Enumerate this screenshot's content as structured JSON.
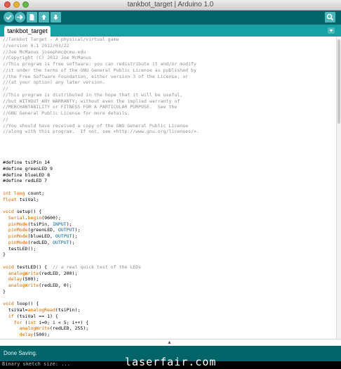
{
  "window": {
    "title": "tankbot_target | Arduino 1.0"
  },
  "toolbar": {
    "buttons": [
      {
        "name": "verify",
        "icon": "check-icon"
      },
      {
        "name": "upload",
        "icon": "right-arrow-icon"
      },
      {
        "name": "new",
        "icon": "new-file-icon"
      },
      {
        "name": "open",
        "icon": "up-arrow-icon"
      },
      {
        "name": "save",
        "icon": "down-arrow-icon"
      },
      {
        "name": "serial-monitor",
        "icon": "magnifier-icon"
      }
    ]
  },
  "tabs": [
    {
      "label": "tankbot_target"
    }
  ],
  "editor": {
    "lines": [
      [
        {
          "t": "//Tankbot Target - A physical/virtual game",
          "c": "comment"
        }
      ],
      [
        {
          "t": "//version 0.1 2012/03/22",
          "c": "comment"
        }
      ],
      [
        {
          "t": "//Joe McManus josephmc@cmu.edu",
          "c": "comment"
        }
      ],
      [
        {
          "t": "//Copyright (C) 2012 Joe McManus",
          "c": "comment"
        }
      ],
      [
        {
          "t": "//This program is free software: you can redistribute it and/or modify",
          "c": "comment"
        }
      ],
      [
        {
          "t": "//it under the terms of the GNU General Public License as published by",
          "c": "comment"
        }
      ],
      [
        {
          "t": "//the Free Software Foundation, either version 3 of the License, or",
          "c": "comment"
        }
      ],
      [
        {
          "t": "//(at your option) any later version.",
          "c": "comment"
        }
      ],
      [
        {
          "t": "//",
          "c": "comment"
        }
      ],
      [
        {
          "t": "//This program is distributed in the hope that it will be useful,",
          "c": "comment"
        }
      ],
      [
        {
          "t": "//but WITHOUT ANY WARRANTY; without even the implied warranty of",
          "c": "comment"
        }
      ],
      [
        {
          "t": "//MERCHANTABILITY or FITNESS FOR A PARTICULAR PURPOSE.  See the",
          "c": "comment"
        }
      ],
      [
        {
          "t": "//GNU General Public License for more details.",
          "c": "comment"
        }
      ],
      [
        {
          "t": "//",
          "c": "comment"
        }
      ],
      [
        {
          "t": "//You should have received a copy of the GNU General Public License",
          "c": "comment"
        }
      ],
      [
        {
          "t": "//along with this program.  If not, see <http://www.gnu.org/licenses/>.",
          "c": "comment"
        }
      ],
      [],
      [],
      [],
      [],
      [
        {
          "t": "#define tsiPin 14"
        }
      ],
      [
        {
          "t": "#define greenLED 9"
        }
      ],
      [
        {
          "t": "#define blueLED 8"
        }
      ],
      [
        {
          "t": "#define redLED 7"
        }
      ],
      [],
      [
        {
          "t": "int",
          "c": "keyword"
        },
        {
          "t": " "
        },
        {
          "t": "long",
          "c": "keyword"
        },
        {
          "t": " count;"
        }
      ],
      [
        {
          "t": "float",
          "c": "keyword"
        },
        {
          "t": " tsiVal;"
        }
      ],
      [],
      [
        {
          "t": "void",
          "c": "keyword"
        },
        {
          "t": " setup() {"
        }
      ],
      [
        {
          "t": "  "
        },
        {
          "t": "Serial",
          "c": "func"
        },
        {
          "t": "."
        },
        {
          "t": "begin",
          "c": "func"
        },
        {
          "t": "(9600);"
        }
      ],
      [
        {
          "t": "  "
        },
        {
          "t": "pinMode",
          "c": "func"
        },
        {
          "t": "(tsiPin, "
        },
        {
          "t": "INPUT",
          "c": "const"
        },
        {
          "t": ");"
        }
      ],
      [
        {
          "t": "  "
        },
        {
          "t": "pinMode",
          "c": "func"
        },
        {
          "t": "(greenLED, "
        },
        {
          "t": "OUTPUT",
          "c": "const"
        },
        {
          "t": ");"
        }
      ],
      [
        {
          "t": "  "
        },
        {
          "t": "pinMode",
          "c": "func"
        },
        {
          "t": "(blueLED, "
        },
        {
          "t": "OUTPUT",
          "c": "const"
        },
        {
          "t": ");"
        }
      ],
      [
        {
          "t": "  "
        },
        {
          "t": "pinMode",
          "c": "func"
        },
        {
          "t": "(redLED, "
        },
        {
          "t": "OUTPUT",
          "c": "const"
        },
        {
          "t": ");"
        }
      ],
      [
        {
          "t": "  testLED();"
        }
      ],
      [
        {
          "t": "}"
        }
      ],
      [],
      [
        {
          "t": "void",
          "c": "keyword"
        },
        {
          "t": " testLED() {  "
        },
        {
          "t": "// a real quick test of the LEDs",
          "c": "comment"
        }
      ],
      [
        {
          "t": "  "
        },
        {
          "t": "analogWrite",
          "c": "func"
        },
        {
          "t": "(redLED, 200);"
        }
      ],
      [
        {
          "t": "  "
        },
        {
          "t": "delay",
          "c": "func"
        },
        {
          "t": "(500);"
        }
      ],
      [
        {
          "t": "  "
        },
        {
          "t": "analogWrite",
          "c": "func"
        },
        {
          "t": "(redLED, 0);"
        }
      ],
      [
        {
          "t": "}"
        }
      ],
      [],
      [
        {
          "t": "void",
          "c": "keyword"
        },
        {
          "t": " loop() {"
        }
      ],
      [
        {
          "t": "  tsiVal="
        },
        {
          "t": "analogRead",
          "c": "func"
        },
        {
          "t": "(tsiPin);"
        }
      ],
      [
        {
          "t": "  "
        },
        {
          "t": "if",
          "c": "keyword"
        },
        {
          "t": " (tsiVal == 1) {"
        }
      ],
      [
        {
          "t": "    "
        },
        {
          "t": "for",
          "c": "keyword"
        },
        {
          "t": " ("
        },
        {
          "t": "int",
          "c": "keyword"
        },
        {
          "t": " i=0; i < 5; i++) {"
        }
      ],
      [
        {
          "t": "      "
        },
        {
          "t": "analogWrite",
          "c": "func"
        },
        {
          "t": "(redLED, 255);"
        }
      ],
      [
        {
          "t": "      "
        },
        {
          "t": "delay",
          "c": "func"
        },
        {
          "t": "(500);"
        }
      ],
      [
        {
          "t": "      "
        },
        {
          "t": "analogWrite",
          "c": "func"
        },
        {
          "t": "(redLED, 0);"
        }
      ],
      [
        {
          "t": "      "
        },
        {
          "t": "analogWrite",
          "c": "func"
        },
        {
          "t": "(greenLED, 255);"
        }
      ],
      [
        {
          "t": "      "
        },
        {
          "t": "delay",
          "c": "func"
        },
        {
          "t": "(500);"
        }
      ]
    ]
  },
  "status": {
    "message": "Done Saving."
  },
  "console": {
    "text": "Binary sketch size: ..."
  },
  "watermark": "laserfair.com",
  "colors": {
    "toolbar": "#006468",
    "tab_strip": "#17a1a5",
    "button": "#4db7bb",
    "comment": "#8f8f8f",
    "keyword": "#cc6600",
    "constant": "#006699"
  }
}
